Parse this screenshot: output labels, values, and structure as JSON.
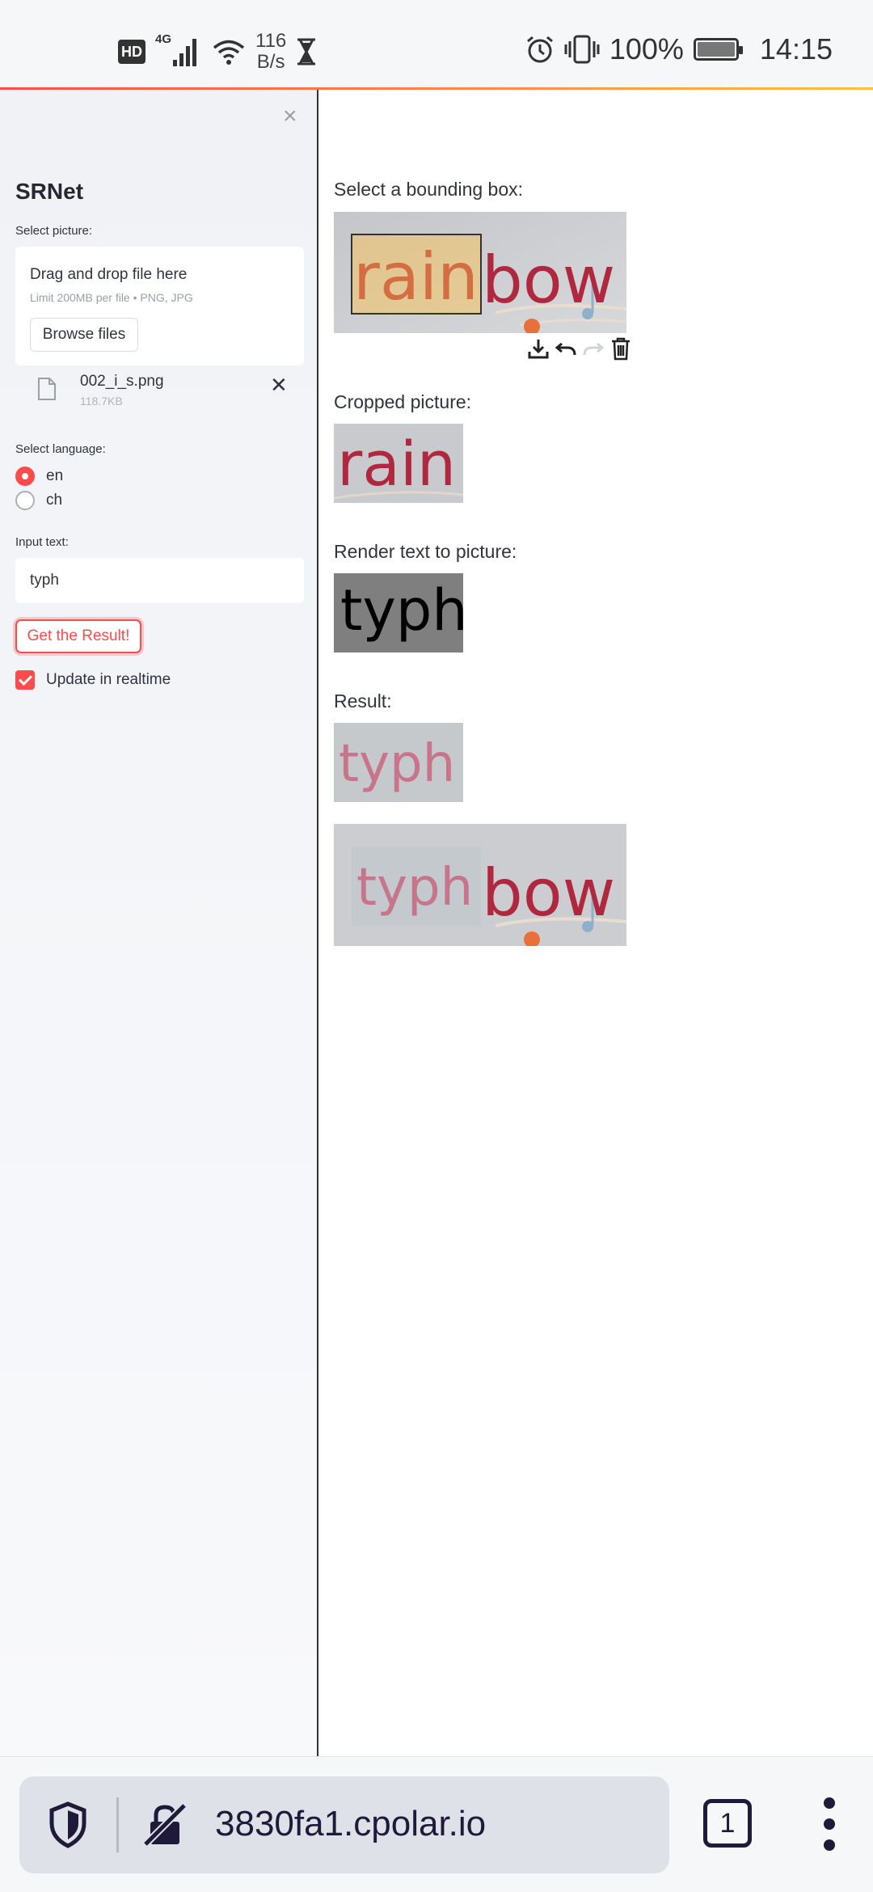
{
  "status_bar": {
    "hd": "HD",
    "network": "4G",
    "speed_value": "116",
    "speed_unit": "B/s",
    "battery": "100%",
    "time": "14:15"
  },
  "sidebar": {
    "close": "×",
    "title": "SRNet",
    "select_picture_label": "Select picture:",
    "uploader": {
      "title": "Drag and drop file here",
      "limit": "Limit 200MB per file • PNG, JPG",
      "browse": "Browse files"
    },
    "file": {
      "name": "002_i_s.png",
      "size": "118.7KB",
      "remove": "✕"
    },
    "language_label": "Select language:",
    "languages": [
      {
        "label": "en",
        "selected": true
      },
      {
        "label": "ch",
        "selected": false
      }
    ],
    "input_label": "Input text:",
    "input_value": "typh",
    "result_button": "Get the Result!",
    "realtime_label": "Update in realtime",
    "realtime_checked": true
  },
  "main": {
    "bbox_label": "Select a bounding box:",
    "cropped_label": "Cropped picture:",
    "render_label": "Render text to picture:",
    "result_label": "Result:",
    "source_word_a": "rain",
    "source_word_b": "bow",
    "render_text": "typh",
    "result_word_a": "typh",
    "result_word_b": "bow"
  },
  "browser": {
    "url": "3830fa1.cpolar.io",
    "tab_count": "1"
  },
  "colors": {
    "accent": "#ff4b4b",
    "sidebar_bg": "#f0f2f6",
    "word_red": "#b0283f",
    "photo_gray": "#c9cbcf"
  }
}
